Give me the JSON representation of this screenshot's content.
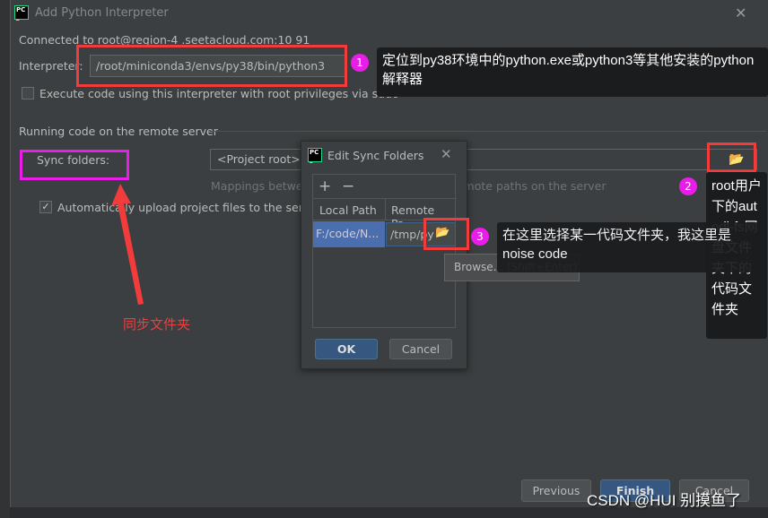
{
  "dialog": {
    "title": "Add Python Interpreter",
    "connected": "Connected to root@region-4 .seetacloud.com:10 91",
    "interpreter_label": "Interpreter:",
    "interpreter_value": "/root/miniconda3/envs/py38/bin/python3",
    "sudo_label": "Execute code using this interpreter with root privileges via sudo",
    "sudo_checked": false,
    "section_title": "Running code on the remote server",
    "sync_label": "Sync folders:",
    "sync_value": "<Project root>→",
    "mappings_hint": "Mappings between local project paths and remote paths on the server",
    "auto_upload_label": "Automatically upload project files to the server",
    "auto_upload_checked": true,
    "buttons": {
      "previous": "Previous",
      "finish": "Finish",
      "cancel": "Cancel"
    }
  },
  "sync_dialog": {
    "title": "Edit Sync Folders",
    "columns": [
      "Local Path",
      "Remote Pa..."
    ],
    "rows": [
      {
        "local": "F:/code/N...",
        "remote": "/tmp/py"
      }
    ],
    "ok": "OK",
    "cancel": "Cancel",
    "browse_tooltip": "Browse... (Shift+Enter)"
  },
  "annotations": {
    "n1": "1",
    "c1": "定位到py38环境中的python.exe或python3等其他安装的python解释器",
    "n2": "2",
    "c2": "root用户下的autodl-fs网盘文件夹下的代码文件夹",
    "n3": "3",
    "c3": "在这里选择某一代码文件夹，我这里是noise code",
    "arrow_label": "同步文件夹"
  },
  "watermark": "CSDN @HUI 别摸鱼了",
  "colors": {
    "annotation_red": "#f23c3c",
    "annotation_magenta": "#e81ee8",
    "accent": "#365880"
  }
}
